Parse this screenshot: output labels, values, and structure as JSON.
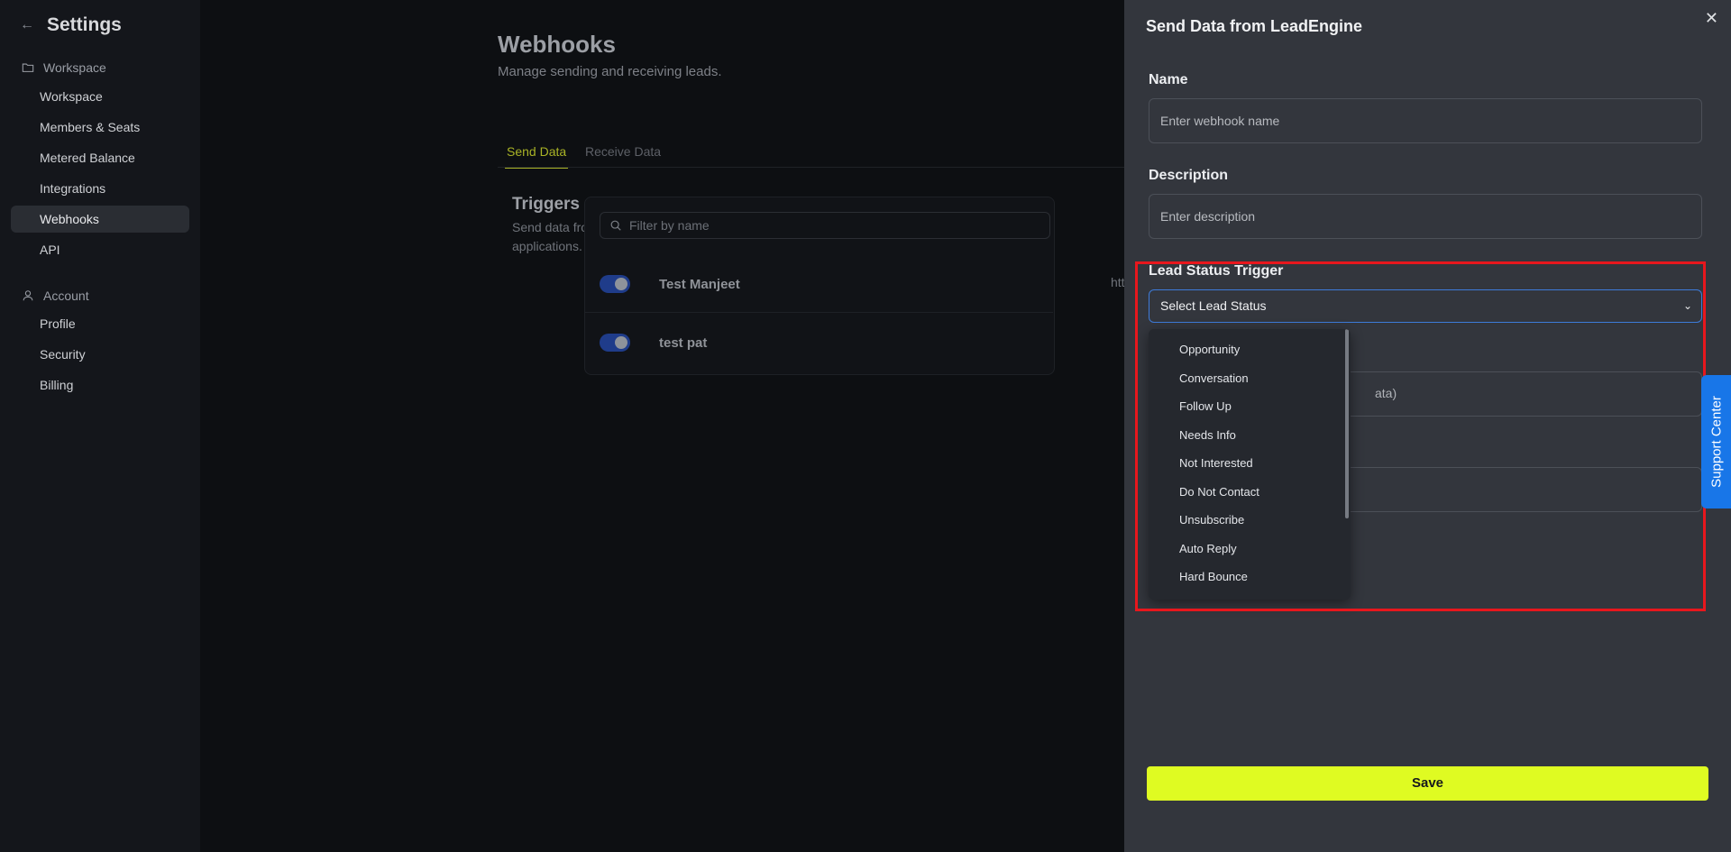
{
  "sidebar": {
    "title": "Settings",
    "sections": [
      {
        "label": "Workspace",
        "items": [
          "Workspace",
          "Members & Seats",
          "Metered Balance",
          "Integrations",
          "Webhooks",
          "API"
        ]
      },
      {
        "label": "Account",
        "items": [
          "Profile",
          "Security",
          "Billing"
        ]
      }
    ],
    "active_item": "Webhooks"
  },
  "main": {
    "title": "Webhooks",
    "subtitle": "Manage sending and receiving leads.",
    "tabs": [
      "Send Data",
      "Receive Data"
    ],
    "active_tab": "Send Data",
    "triggers": {
      "title": "Triggers",
      "description": "Send data from LeadEngine to other applications."
    },
    "filter_placeholder": "Filter by name",
    "webhooks": [
      {
        "name": "Test Manjeet",
        "url_fragment": "htt",
        "enabled": true
      },
      {
        "name": "test pat",
        "enabled": true
      }
    ]
  },
  "drawer": {
    "title": "Send Data from LeadEngine",
    "close_icon": "x-icon",
    "name_label": "Name",
    "name_placeholder": "Enter webhook name",
    "description_label": "Description",
    "description_placeholder": "Enter description",
    "lead_status_label": "Lead Status Trigger",
    "lead_status_placeholder": "Select Lead Status",
    "lead_status_options": [
      "Opportunity",
      "Conversation",
      "Follow Up",
      "Needs Info",
      "Not Interested",
      "Do Not Contact",
      "Unsubscribe",
      "Auto Reply",
      "Hard Bounce"
    ],
    "partial_text": "ata)",
    "save_label": "Save"
  },
  "support_tab": "Support Center",
  "colors": {
    "accent": "#dffb22",
    "active_tab": "#a9b326",
    "select_border": "#3d7bd9",
    "highlight": "#e8171d",
    "support": "#1876e8"
  }
}
